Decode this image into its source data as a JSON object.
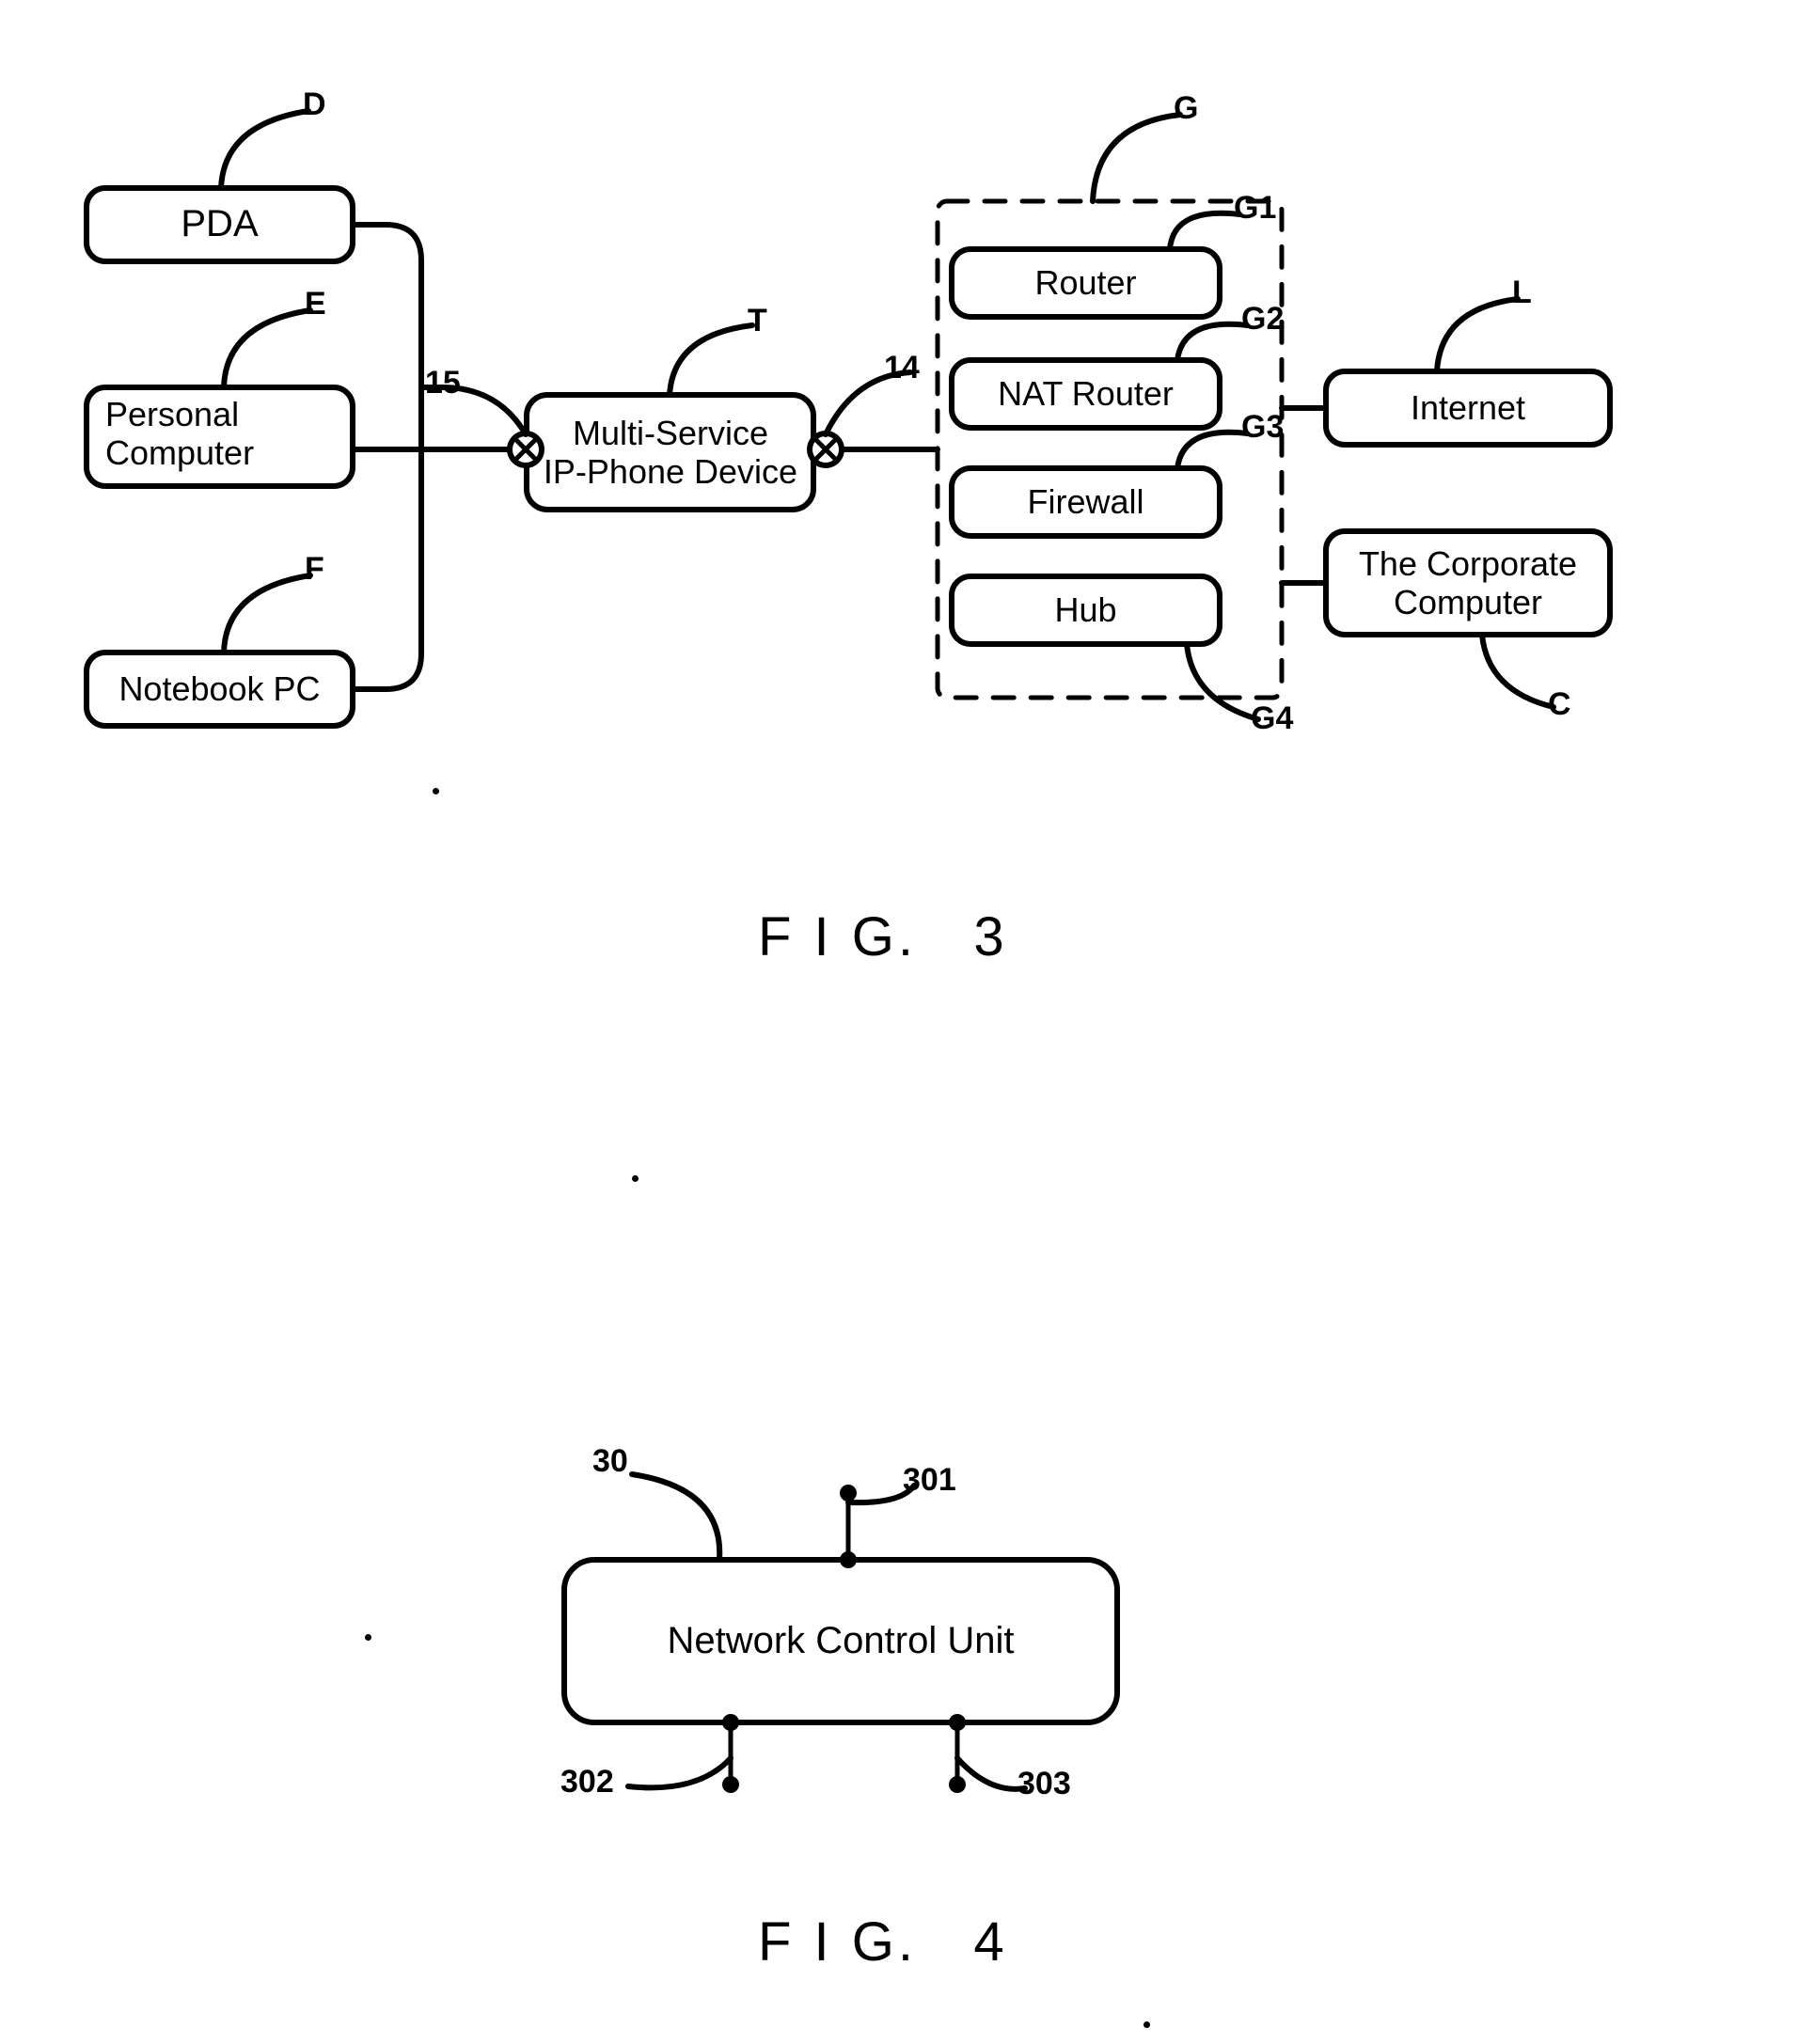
{
  "document": {
    "type": "patent-drawing-sheet",
    "figures": [
      {
        "caption": "F I G.   3",
        "title_prefix": "F I G.",
        "number": "3",
        "nodes": [
          {
            "id": "pda",
            "label": "PDA",
            "ref": "D"
          },
          {
            "id": "pc",
            "label": "Personal\nComputer",
            "ref": "E"
          },
          {
            "id": "notebook",
            "label": "Notebook PC",
            "ref": "F"
          },
          {
            "id": "ipphone",
            "label": "Multi-Service\nIP-Phone Device",
            "ref": "T"
          },
          {
            "id": "router",
            "label": "Router",
            "ref": "G1"
          },
          {
            "id": "natrouter",
            "label": "NAT Router",
            "ref": "G2"
          },
          {
            "id": "firewall",
            "label": "Firewall",
            "ref": "G3"
          },
          {
            "id": "hub",
            "label": "Hub",
            "ref": "G4"
          },
          {
            "id": "internet",
            "label": "Internet",
            "ref": "L"
          },
          {
            "id": "corporate",
            "label": "The Corporate\nComputer",
            "ref": "C"
          }
        ],
        "group": {
          "id": "gateway",
          "ref": "G",
          "style": "dashed-boundary"
        },
        "port_refs": [
          {
            "id": "port15",
            "label": "15",
            "at": "ip-phone-left-connector"
          },
          {
            "id": "port14",
            "label": "14",
            "at": "ip-phone-right-connector"
          }
        ]
      },
      {
        "caption": "F I G.   4",
        "title_prefix": "F I G.",
        "number": "4",
        "nodes": [
          {
            "id": "ncu",
            "label": "Network Control Unit",
            "ref": "30"
          }
        ],
        "port_refs": [
          {
            "id": "p301",
            "label": "301",
            "at": "top"
          },
          {
            "id": "p302",
            "label": "302",
            "at": "bottom-left"
          },
          {
            "id": "p303",
            "label": "303",
            "at": "bottom-right"
          }
        ]
      }
    ]
  },
  "fig3": {
    "caption": "F I G.   3",
    "nodes": {
      "pda": {
        "label": "PDA"
      },
      "pc_line1": {
        "label": "Personal"
      },
      "pc_line2": {
        "label": "Computer"
      },
      "notebook": {
        "label": "Notebook PC"
      },
      "ipphone_line1": {
        "label": "Multi-Service"
      },
      "ipphone_line2": {
        "label": "IP-Phone Device"
      },
      "router": {
        "label": "Router"
      },
      "natrouter": {
        "label": "NAT Router"
      },
      "firewall": {
        "label": "Firewall"
      },
      "hub": {
        "label": "Hub"
      },
      "internet": {
        "label": "Internet"
      },
      "corp_line1": {
        "label": "The Corporate"
      },
      "corp_line2": {
        "label": "Computer"
      }
    },
    "refs": {
      "d": "D",
      "e": "E",
      "f": "F",
      "t": "T",
      "g": "G",
      "g1": "G1",
      "g2": "G2",
      "g3": "G3",
      "g4": "G4",
      "l": "L",
      "c": "C",
      "n15": "15",
      "n14": "14"
    }
  },
  "fig4": {
    "caption": "F I G.   4",
    "nodes": {
      "ncu": {
        "label": "Network Control Unit"
      }
    },
    "refs": {
      "n30": "30",
      "n301": "301",
      "n302": "302",
      "n303": "303"
    }
  },
  "style": {
    "ink": "#000000",
    "paper": "#ffffff"
  }
}
